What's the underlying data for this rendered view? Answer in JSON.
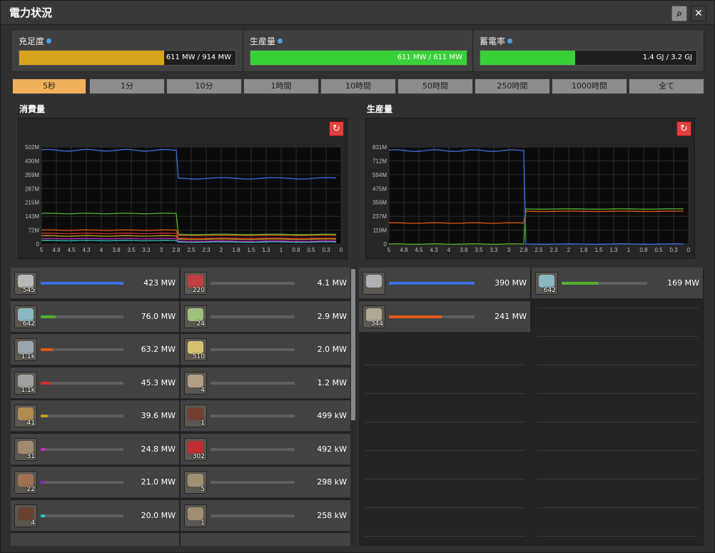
{
  "window": {
    "title": "電力状況",
    "search_icon": "⌕",
    "close_icon": "✕"
  },
  "summary": [
    {
      "label": "充足度",
      "value": "611 MW / 914 MW",
      "fill": 0.67,
      "color": "#d7a41c"
    },
    {
      "label": "生産量",
      "value": "611 MW / 611 MW",
      "fill": 1.0,
      "color": "#3ad03a"
    },
    {
      "label": "蓄電率",
      "value": "1.4 GJ / 3.2 GJ",
      "fill": 0.44,
      "color": "#3ad03a"
    }
  ],
  "time_buttons": [
    "5秒",
    "1分",
    "10分",
    "1時間",
    "10時間",
    "50時間",
    "250時間",
    "1000時間",
    "全て"
  ],
  "consumption": {
    "title": "消費量",
    "y_ticks": [
      "502M",
      "430M",
      "359M",
      "287M",
      "215M",
      "143M",
      "72M",
      "0"
    ],
    "x_ticks": [
      "5",
      "4.8",
      "4.5",
      "4.3",
      "4",
      "3.8",
      "3.5",
      "3.3",
      "3",
      "2.8",
      "2.5",
      "2.3",
      "2",
      "1.8",
      "1.5",
      "1.3",
      "1",
      "0.8",
      "0.5",
      "0.3",
      "0"
    ],
    "ymax": 502,
    "series": [
      {
        "color": "#3c6fe0",
        "before": 485,
        "after": 340
      },
      {
        "color": "#55b030",
        "before": 158,
        "after": 50
      },
      {
        "color": "#e05a18",
        "before": 72,
        "after": 45
      },
      {
        "color": "#d03030",
        "before": 55,
        "after": 30
      },
      {
        "color": "#c0a020",
        "before": 42,
        "after": 25
      },
      {
        "color": "#c030c0",
        "before": 28,
        "after": 15
      },
      {
        "color": "#30c0c0",
        "before": 18,
        "after": 10
      }
    ],
    "items": [
      {
        "count": "545",
        "value": "423 MW",
        "fill": 1.0,
        "color": "#3c6fe0",
        "glyph": "#b8b8b8",
        "col": 0
      },
      {
        "count": "220",
        "value": "4.1 MW",
        "fill": 0.0,
        "color": "#3c6fe0",
        "glyph": "#c04040",
        "col": 1
      },
      {
        "count": "642",
        "value": "76.0 MW",
        "fill": 0.18,
        "color": "#55b030",
        "glyph": "#8ab8c0",
        "col": 0
      },
      {
        "count": "24",
        "value": "2.9 MW",
        "fill": 0.0,
        "color": "#55b030",
        "glyph": "#a0c080",
        "col": 1
      },
      {
        "count": "1.1k",
        "value": "63.2 MW",
        "fill": 0.15,
        "color": "#e05a18",
        "glyph": "#9aa6b0",
        "col": 0
      },
      {
        "count": "510",
        "value": "2.0 MW",
        "fill": 0.0,
        "color": "#e05a18",
        "glyph": "#d8c070",
        "col": 1
      },
      {
        "count": "1.1k",
        "value": "45.3 MW",
        "fill": 0.11,
        "color": "#d03030",
        "glyph": "#a0a0a0",
        "col": 0
      },
      {
        "count": "4",
        "value": "1.2 MW",
        "fill": 0.0,
        "color": "#d03030",
        "glyph": "#b0a080",
        "col": 1
      },
      {
        "count": "41",
        "value": "39.6 MW",
        "fill": 0.09,
        "color": "#c0a020",
        "glyph": "#b08a50",
        "col": 0
      },
      {
        "count": "1",
        "value": "499 kW",
        "fill": 0.0,
        "color": "#c0a020",
        "glyph": "#704030",
        "col": 1
      },
      {
        "count": "31",
        "value": "24.8 MW",
        "fill": 0.06,
        "color": "#c030c0",
        "glyph": "#a08a70",
        "col": 0
      },
      {
        "count": "302",
        "value": "492 kW",
        "fill": 0.0,
        "color": "#c030c0",
        "glyph": "#c03030",
        "col": 1
      },
      {
        "count": "22",
        "value": "21.0 MW",
        "fill": 0.05,
        "color": "#8030c0",
        "glyph": "#a07050",
        "col": 0
      },
      {
        "count": "5",
        "value": "298 kW",
        "fill": 0.0,
        "color": "#8030c0",
        "glyph": "#a09070",
        "col": 1
      },
      {
        "count": "4",
        "value": "20.0 MW",
        "fill": 0.05,
        "color": "#30c0c0",
        "glyph": "#6a4030",
        "col": 0
      },
      {
        "count": "1",
        "value": "258 kW",
        "fill": 0.0,
        "color": "#30c0c0",
        "glyph": "#a09070",
        "col": 1
      }
    ]
  },
  "production": {
    "title": "生産量",
    "y_ticks": [
      "831M",
      "712M",
      "594M",
      "475M",
      "356M",
      "237M",
      "119M",
      "0"
    ],
    "x_ticks": [
      "5",
      "4.8",
      "4.5",
      "4.3",
      "4",
      "3.8",
      "3.5",
      "3.3",
      "3",
      "2.8",
      "2.5",
      "2.3",
      "2",
      "1.8",
      "1.5",
      "1.3",
      "1",
      "0.8",
      "0.5",
      "0.3",
      "0"
    ],
    "ymax": 831,
    "series": [
      {
        "color": "#3c6fe0",
        "before": 800,
        "after": 0
      },
      {
        "color": "#e05a18",
        "before": 180,
        "after": 280
      },
      {
        "color": "#55b030",
        "before": 0,
        "after": 300
      }
    ],
    "items": [
      {
        "count": "",
        "value": "390 MW",
        "fill": 1.0,
        "color": "#3c6fe0",
        "glyph": "#b0b0b0"
      },
      {
        "count": "642",
        "value": "169 MW",
        "fill": 0.43,
        "color": "#55b030",
        "glyph": "#8ab8c0"
      },
      {
        "count": "344",
        "value": "241 MW",
        "fill": 0.62,
        "color": "#e05a18",
        "glyph": "#b0a890"
      }
    ]
  }
}
